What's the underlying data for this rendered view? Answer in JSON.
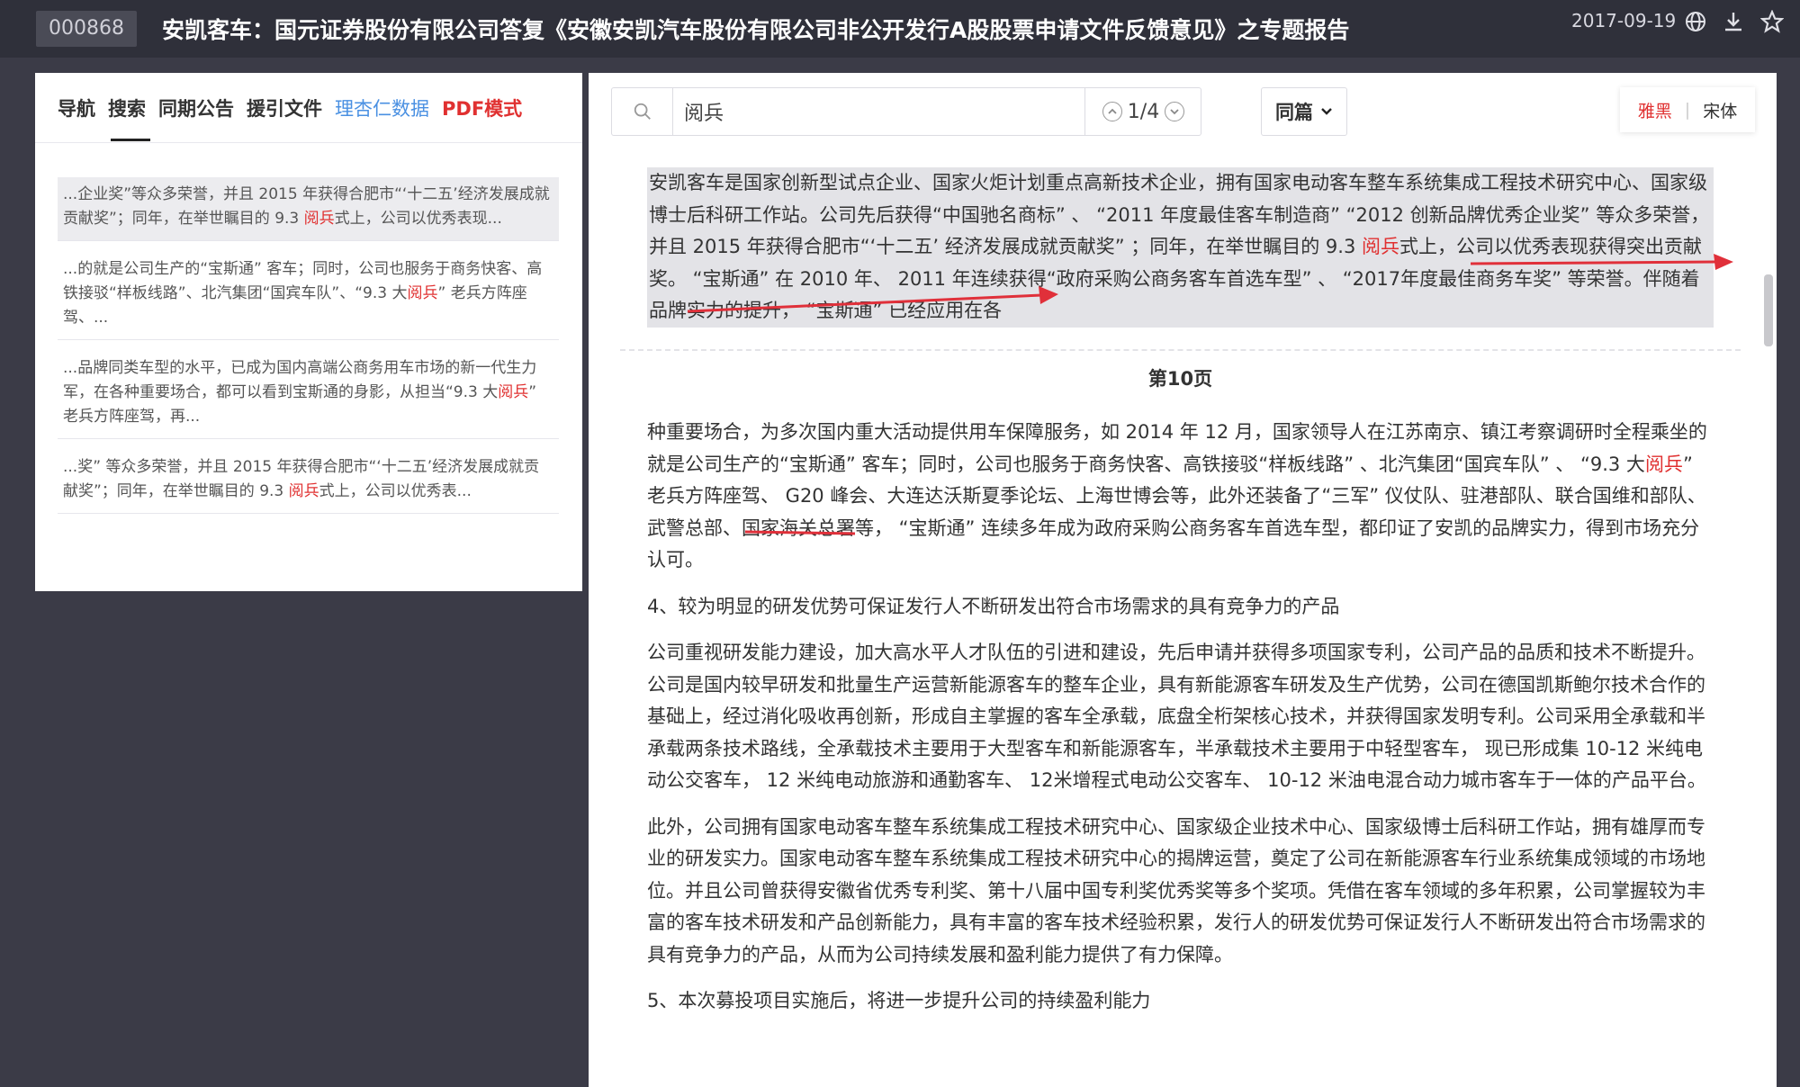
{
  "topbar": {
    "stock_code": "000868",
    "title": "安凯客车：国元证券股份有限公司答复《安徽安凯汽车股份有限公司非公开发行A股股票申请文件反馈意见》之专题报告",
    "date": "2017-09-19",
    "icons": [
      "globe-icon",
      "download-icon",
      "star-icon"
    ]
  },
  "left_panel": {
    "tabs": [
      {
        "label": "导航"
      },
      {
        "label": "搜索"
      },
      {
        "label": "同期公告"
      },
      {
        "label": "援引文件"
      },
      {
        "label": "理杏仁数据"
      },
      {
        "label": "PDF模式"
      }
    ],
    "results": [
      {
        "pre": "...企业奖”等众多荣誉，并且 2015 年获得合肥市“‘十二五’经济发展成就贡献奖”；同年，在举世瞩目的 9.3 ",
        "hl": "阅兵",
        "post": "式上，公司以优秀表现..."
      },
      {
        "pre": "...的就是公司生产的“宝斯通” 客车；同时，公司也服务于商务快客、高铁接驳“样板线路”、北汽集团“国宾车队”、“9.3 大",
        "hl": "阅兵",
        "post": "” 老兵方阵座驾、..."
      },
      {
        "pre": "...品牌同类车型的水平，已成为国内高端公商务用车市场的新一代生力军，在各种重要场合，都可以看到宝斯通的身影，从担当“9.3 大",
        "hl": "阅兵",
        "post": "” 老兵方阵座驾，再..."
      },
      {
        "pre": "...奖” 等众多荣誉，并且 2015 年获得合肥市“‘十二五’经济发展成就贡献奖”；同年，在举世瞩目的 9.3 ",
        "hl": "阅兵",
        "post": "式上，公司以优秀表..."
      }
    ]
  },
  "search": {
    "value": "阅兵",
    "counter": "1/4",
    "scope": "同篇",
    "font_yahei": "雅黑",
    "font_song": "宋体"
  },
  "document": {
    "prev_pre": "安凯客车是国家创新型试点企业、国家火炬计划重点高新技术企业，拥有国家电动客车整车系统集成工程技术研究中心、国家级博士后科研工作站。公司先后获得“中国驰名商标” 、 “2011 年度最佳客车制造商” “2012 创新品牌优秀企业奖” 等众多荣誉，并且 2015 年获得合肥市“‘十二五’ 经济发展成就贡献奖” ；同年，在举世瞩目的 9.3 ",
    "prev_hl": "阅兵",
    "prev_post": "式上，公司以优秀表现获得突出贡献奖。 “宝斯通” 在 2010 年、 2011 年连续获得“政府采购公商务客车首选车型” 、 “2017年度最佳商务车奖” 等荣誉。伴随着品牌实力的提升， “宝斯通” 已经应用在各",
    "page_label": "第10页",
    "p1_pre": "种重要场合，为多次国内重大活动提供用车保障服务，如 2014 年 12 月，国家领导人在江苏南京、镇江考察调研时全程乘坐的就是公司生产的“宝斯通” 客车；同时，公司也服务于商务快客、高铁接驳“样板线路” 、北汽集团“国宾车队” 、 “9.3 大",
    "p1_hl": "阅兵",
    "p1_post": "” 老兵方阵座驾、 G20 峰会、大连达沃斯夏季论坛、上海世博会等，此外还装备了“三军” 仪仗队、驻港部队、联合国维和部队、武警总部、国家海关总署等， “宝斯通” 连续多年成为政府采购公商务客车首选车型，都印证了安凯的品牌实力，得到市场充分认可。",
    "h4": "4、较为明显的研发优势可保证发行人不断研发出符合市场需求的具有竞争力的产品",
    "p2": "公司重视研发能力建设，加大高水平人才队伍的引进和建设，先后申请并获得多项国家专利，公司产品的品质和技术不断提升。公司是国内较早研发和批量生产运营新能源客车的整车企业，具有新能源客车研发及生产优势，公司在德国凯斯鲍尔技术合作的基础上，经过消化吸收再创新，形成自主掌握的客车全承载，底盘全桁架核心技术，并获得国家发明专利。公司采用全承载和半承载两条技术路线，全承载技术主要用于大型客车和新能源客车，半承载技术主要用于中轻型客车， 现已形成集 10-12 米纯电动公交客车， 12 米纯电动旅游和通勤客车、 12米增程式电动公交客车、 10-12 米油电混合动力城市客车于一体的产品平台。",
    "p3": "此外，公司拥有国家电动客车整车系统集成工程技术研究中心、国家级企业技术中心、国家级博士后科研工作站，拥有雄厚而专业的研发实力。国家电动客车整车系统集成工程技术研究中心的揭牌运营，奠定了公司在新能源客车行业系统集成领域的市场地位。并且公司曾获得安徽省优秀专利奖、第十八届中国专利奖优秀奖等多个奖项。凭借在客车领域的多年积累，公司掌握较为丰富的客车技术研发和产品创新能力，具有丰富的客车技术经验积累，发行人的研发优势可保证发行人不断研发出符合市场需求的具有竞争力的产品，从而为公司持续发展和盈利能力提供了有力保障。",
    "h5": "5、本次募投项目实施后，将进一步提升公司的持续盈利能力"
  },
  "colors": {
    "highlight": "#e03030",
    "link_blue": "#4a90e2",
    "background": "#3b3b47"
  }
}
